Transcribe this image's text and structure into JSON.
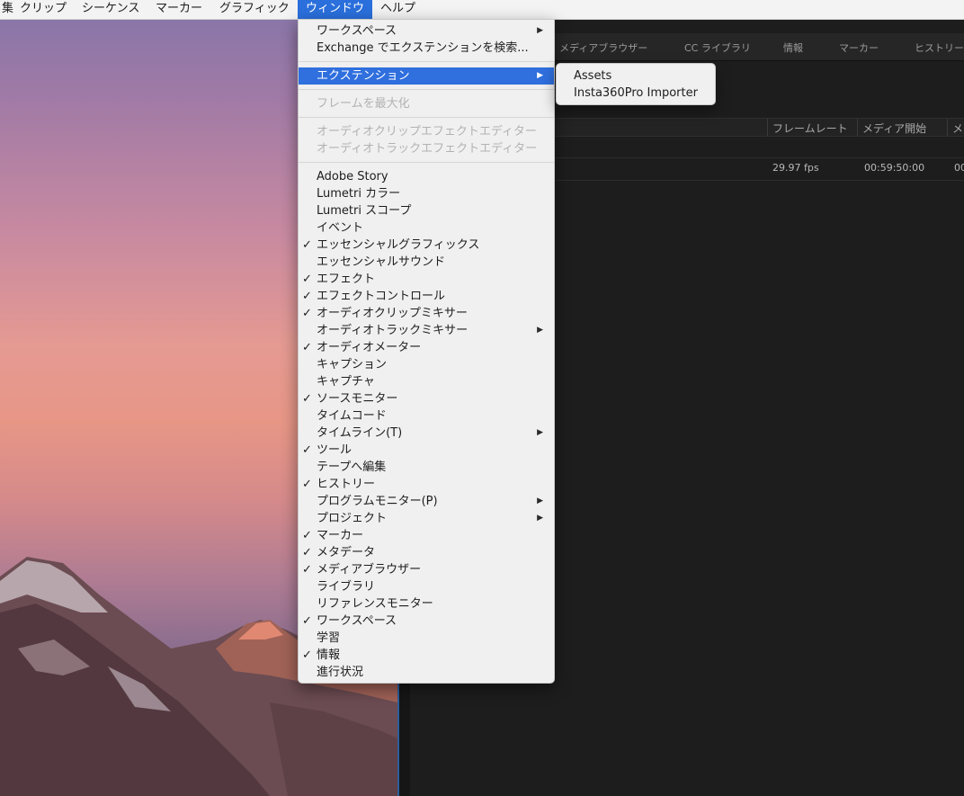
{
  "menubar": {
    "items": [
      {
        "label": "集"
      },
      {
        "label": "クリップ"
      },
      {
        "label": "シーケンス"
      },
      {
        "label": "マーカー"
      },
      {
        "label": "グラフィック"
      },
      {
        "label": "ウィンドウ"
      },
      {
        "label": "ヘルプ"
      }
    ],
    "active_index": 5
  },
  "window_menu": {
    "top_items": [
      {
        "label": "ワークスペース",
        "submenu": true
      },
      {
        "label": "Exchange でエクステンションを検索..."
      }
    ],
    "extensions": {
      "label": "エクステンション",
      "submenu": true,
      "highlighted": true
    },
    "maximize": {
      "label": "フレームを最大化",
      "disabled": true
    },
    "editors": [
      {
        "label": "オーディオクリップエフェクトエディター",
        "disabled": true
      },
      {
        "label": "オーディオトラックエフェクトエディター",
        "disabled": true
      }
    ],
    "panels": [
      {
        "label": "Adobe Story",
        "checked": false,
        "submenu": false
      },
      {
        "label": "Lumetri カラー",
        "checked": false,
        "submenu": false
      },
      {
        "label": "Lumetri スコープ",
        "checked": false,
        "submenu": false
      },
      {
        "label": "イベント",
        "checked": false,
        "submenu": false
      },
      {
        "label": "エッセンシャルグラフィックス",
        "checked": true,
        "submenu": false
      },
      {
        "label": "エッセンシャルサウンド",
        "checked": false,
        "submenu": false
      },
      {
        "label": "エフェクト",
        "checked": true,
        "submenu": false
      },
      {
        "label": "エフェクトコントロール",
        "checked": true,
        "submenu": false
      },
      {
        "label": "オーディオクリップミキサー",
        "checked": true,
        "submenu": false
      },
      {
        "label": "オーディオトラックミキサー",
        "checked": false,
        "submenu": true
      },
      {
        "label": "オーディオメーター",
        "checked": true,
        "submenu": false
      },
      {
        "label": "キャプション",
        "checked": false,
        "submenu": false
      },
      {
        "label": "キャプチャ",
        "checked": false,
        "submenu": false
      },
      {
        "label": "ソースモニター",
        "checked": true,
        "submenu": false
      },
      {
        "label": "タイムコード",
        "checked": false,
        "submenu": false
      },
      {
        "label": "タイムライン(T)",
        "checked": false,
        "submenu": true
      },
      {
        "label": "ツール",
        "checked": true,
        "submenu": false
      },
      {
        "label": "テープへ編集",
        "checked": false,
        "submenu": false
      },
      {
        "label": "ヒストリー",
        "checked": true,
        "submenu": false
      },
      {
        "label": "プログラムモニター(P)",
        "checked": false,
        "submenu": true
      },
      {
        "label": "プロジェクト",
        "checked": false,
        "submenu": true
      },
      {
        "label": "マーカー",
        "checked": true,
        "submenu": false
      },
      {
        "label": "メタデータ",
        "checked": true,
        "submenu": false
      },
      {
        "label": "メディアブラウザー",
        "checked": true,
        "submenu": false
      },
      {
        "label": "ライブラリ",
        "checked": false,
        "submenu": false
      },
      {
        "label": "リファレンスモニター",
        "checked": false,
        "submenu": false
      },
      {
        "label": "ワークスペース",
        "checked": true,
        "submenu": false
      },
      {
        "label": "学習",
        "checked": false,
        "submenu": false
      },
      {
        "label": "情報",
        "checked": true,
        "submenu": false
      },
      {
        "label": "進行状況",
        "checked": false,
        "submenu": false
      }
    ],
    "check_glyph": "✓",
    "arrow_glyph": "▶"
  },
  "extensions_submenu": {
    "items": [
      {
        "label": "Assets"
      },
      {
        "label": "Insta360Pro Importer"
      }
    ]
  },
  "app_panels": {
    "tabs": [
      "メディアブラウザー",
      "CC ライブラリ",
      "情報",
      "マーカー",
      "ヒストリー"
    ],
    "columns": [
      "フレームレート",
      "メディア開始",
      "メ"
    ],
    "row": {
      "frame_rate": "29.97 fps",
      "media_start": "00:59:50:00",
      "extra": "00"
    }
  },
  "colors": {
    "highlight": "#2f6fde",
    "menu_bg": "#f0f0f0",
    "app_bg": "#1d1d1d"
  }
}
